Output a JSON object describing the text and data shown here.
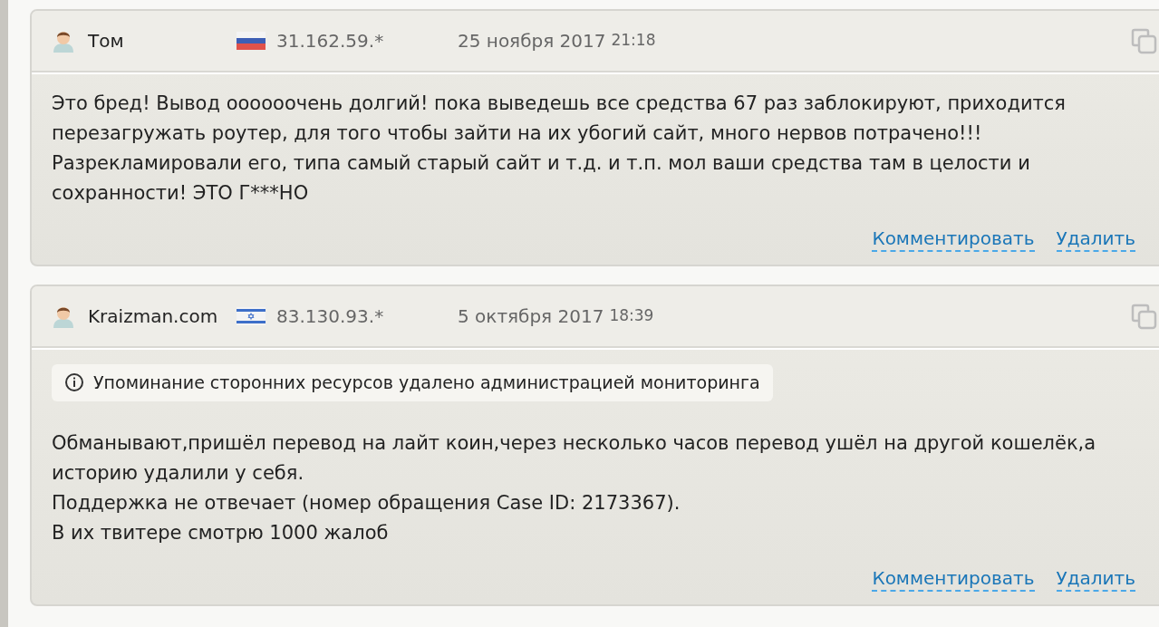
{
  "comments": [
    {
      "author": "Том",
      "flag": {
        "kind": "ru"
      },
      "ip": "31.162.59.*",
      "date": "25 ноября 2017",
      "time": "21:18",
      "lines": [
        "Это бред! Вывод оооооочень долгий! пока выведешь все средства 67 раз заблокируют, приходится",
        "перезагружать роутер, для того чтобы зайти на их убогий сайт, много нервов потрачено!!!",
        "Разрекламировали его, типа самый старый сайт и т.д. и т.п. мол ваши средства там в целости и",
        "сохранности! ЭТО Г***НО"
      ],
      "actions": [
        "Комментировать",
        "Удалить"
      ]
    },
    {
      "author": "Kraizman.com",
      "flag": {
        "kind": "il"
      },
      "ip": "83.130.93.*",
      "date": "5 октября 2017",
      "time": "18:39",
      "notice": "Упоминание сторонних ресурсов удалено администрацией мониторинга",
      "lines": [
        "Обманывают,пришёл перевод на лайт коин,через несколько часов перевод ушёл на другой кошелёк,а",
        "историю удалили у себя.",
        "Поддержка не отвечает (номер обращения Case ID: 2173367).",
        "В их твитере смотрю 1000 жалоб"
      ],
      "actions": [
        "Комментировать",
        "Удалить"
      ]
    }
  ]
}
